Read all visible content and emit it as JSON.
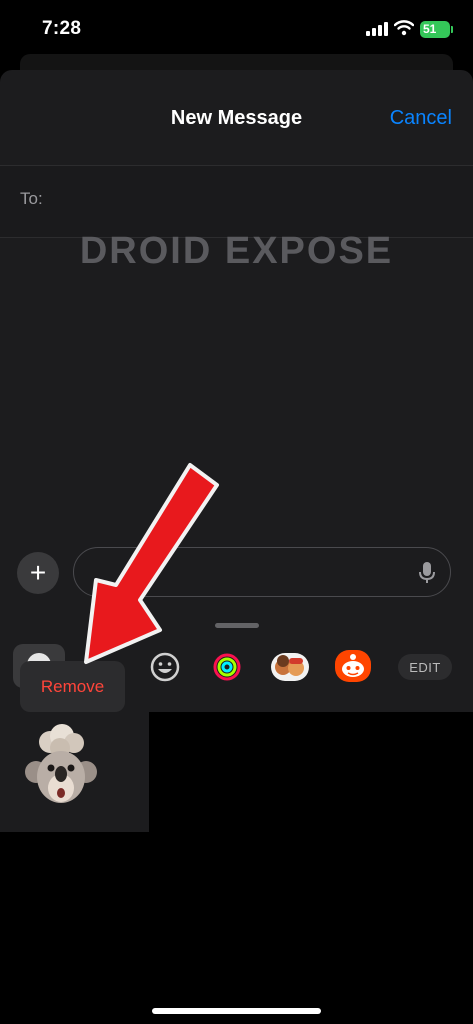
{
  "status_bar": {
    "time": "7:28",
    "battery": "51"
  },
  "header": {
    "title": "New Message",
    "cancel_label": "Cancel"
  },
  "recipient": {
    "label": "To:",
    "value": ""
  },
  "watermark": "DROID EXPOSE",
  "composer": {
    "message_placeholder": ""
  },
  "app_drawer": {
    "apps": [
      {
        "name": "camera-app-icon"
      },
      {
        "name": "emoji-stickers-icon"
      },
      {
        "name": "activity-icon"
      },
      {
        "name": "memoji-stickers-icon"
      },
      {
        "name": "reddit-icon"
      }
    ],
    "edit_label": "EDIT"
  },
  "context_menu": {
    "remove_label": "Remove"
  },
  "colors": {
    "accent": "#0a84ff",
    "destructive": "#ff453a",
    "arrow": "#e8191d",
    "battery": "#34c759"
  }
}
